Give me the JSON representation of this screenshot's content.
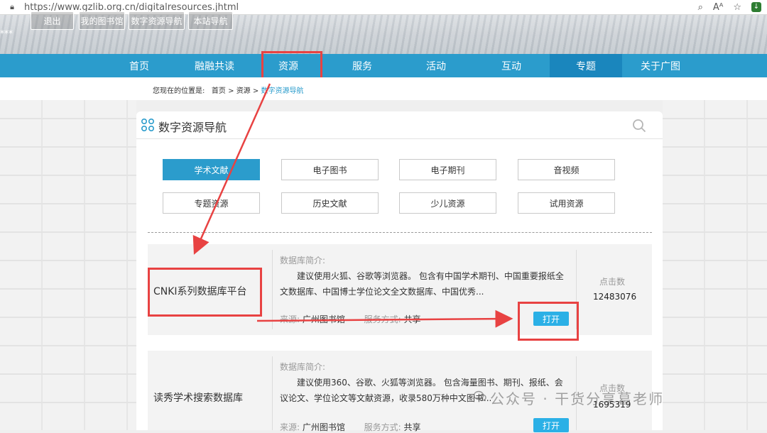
{
  "browser": {
    "url": "https://www.gzlib.org.cn/digitalresources.jhtml",
    "icons": [
      "lock-icon",
      "zoom-icon",
      "read-aloud-icon",
      "favorite-icon",
      "extension-icon"
    ]
  },
  "top": {
    "masked_user": "***",
    "buttons": [
      "退出",
      "我的图书馆",
      "数字资源导航",
      "本站导航"
    ]
  },
  "nav": {
    "items": [
      "首页",
      "融融共读",
      "资源",
      "服务",
      "活动",
      "互动",
      "专题",
      "关于广图"
    ],
    "active": "专题",
    "highlighted": "资源"
  },
  "breadcrumb": {
    "prefix": "您现在的位置是:",
    "home": "首页",
    "sep": ">",
    "resource": "资源",
    "current": "数字资源导航"
  },
  "panel": {
    "title": "数字资源导航",
    "categories": [
      "学术文献",
      "电子图书",
      "电子期刊",
      "音视频",
      "专题资源",
      "历史文献",
      "少儿资源",
      "试用资源"
    ],
    "active_category": "学术文献"
  },
  "databases": [
    {
      "name": "CNKI系列数据库平台",
      "intro_label": "数据库简介:",
      "description": "建议使用火狐、谷歌等浏览器。 包含有中国学术期刊、中国重要报纸全文数据库、中国博士学位论文全文数据库、中国优秀...",
      "source_label": "来源:",
      "source": "广州图书馆",
      "service_label": "服务方式:",
      "service": "共享",
      "clicks_label": "点击数",
      "clicks": "12483076",
      "open_label": "打开"
    },
    {
      "name": "读秀学术搜索数据库",
      "intro_label": "数据库简介:",
      "description": "建议使用360、谷歌、火狐等浏览器。 包含海量图书、期刊、报纸、会议论文、学位论文等文献资源，收录580万种中文图书...",
      "source_label": "来源:",
      "source": "广州图书馆",
      "service_label": "服务方式:",
      "service": "共享",
      "clicks_label": "点击数",
      "clicks": "1695319",
      "open_label": "打开"
    }
  ],
  "watermark": "公众号 · 干货分享葛老师",
  "colors": {
    "nav": "#2b9ccc",
    "nav_active": "#1a86bd",
    "highlight": "#e84242",
    "button": "#2bb0e6"
  }
}
